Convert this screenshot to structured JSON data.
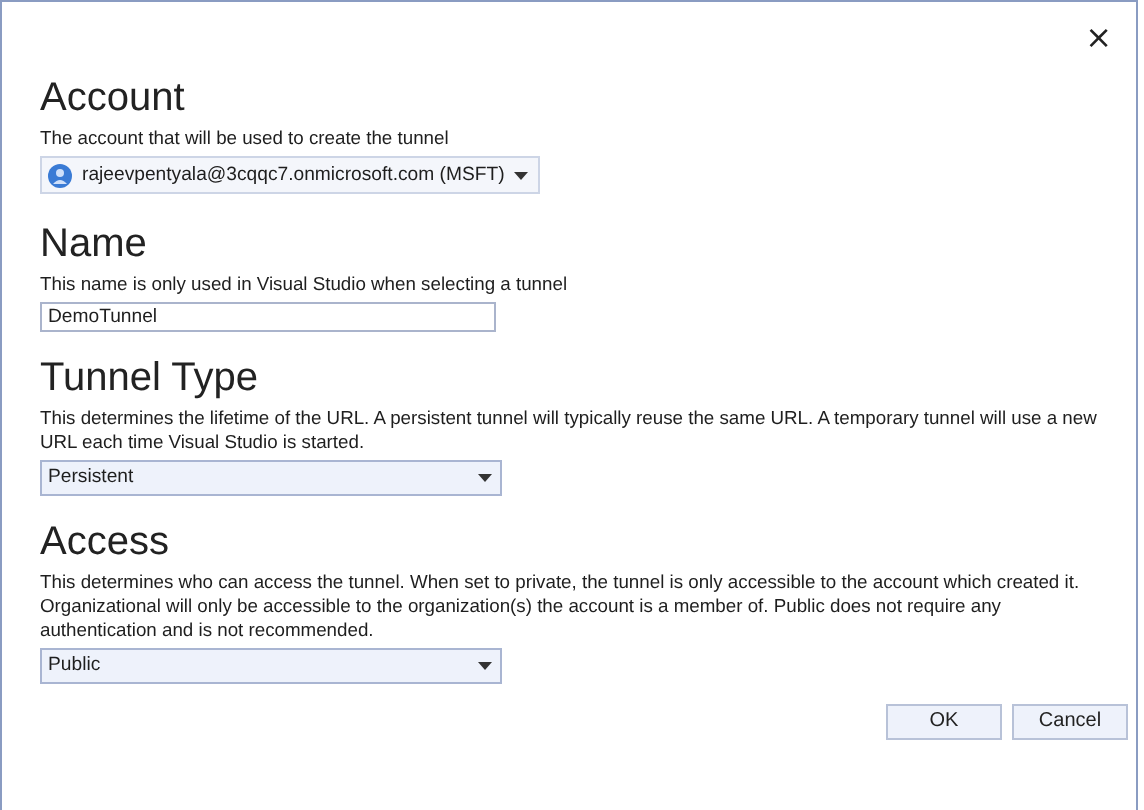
{
  "close_button": "×",
  "sections": [
    {
      "kind": "account",
      "heading": "Account",
      "description": "The account that will be used to create the tunnel",
      "value": "rajeevpentyala@3cqqc7.onmicrosoft.com (MSFT)"
    },
    {
      "kind": "text",
      "heading": "Name",
      "description": "This name is only used in Visual Studio when selecting a tunnel",
      "value": "DemoTunnel"
    },
    {
      "kind": "dropdown",
      "heading": "Tunnel Type",
      "description": "This determines the lifetime of the URL. A persistent tunnel will typically reuse the same URL. A temporary tunnel will use a new URL each time Visual Studio is started.",
      "value": "Persistent"
    },
    {
      "kind": "dropdown",
      "heading": "Access",
      "description": "This determines who can access the tunnel. When set to private, the tunnel is only accessible to the account which created it. Organizational will only be accessible to the organization(s) the account is a member of. Public does not require any authentication and is not recommended.",
      "value": "Public"
    }
  ],
  "buttons": [
    "OK",
    "Cancel"
  ]
}
